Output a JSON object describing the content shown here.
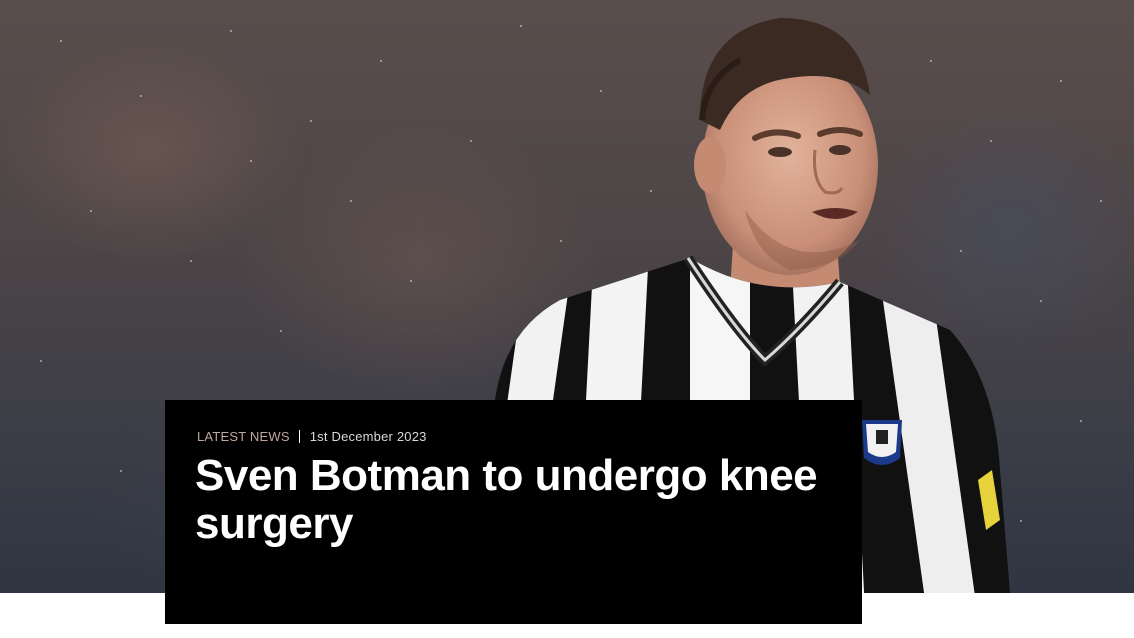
{
  "article": {
    "category": "LATEST NEWS",
    "date": "1st December 2023",
    "headline": "Sven Botman to undergo knee surgery"
  },
  "hero_image": {
    "subject": "footballer in black and white striped kit",
    "icon": "player-photo"
  },
  "colors": {
    "card_background": "#000000",
    "headline_text": "#ffffff",
    "category_text": "#bfa79a"
  }
}
